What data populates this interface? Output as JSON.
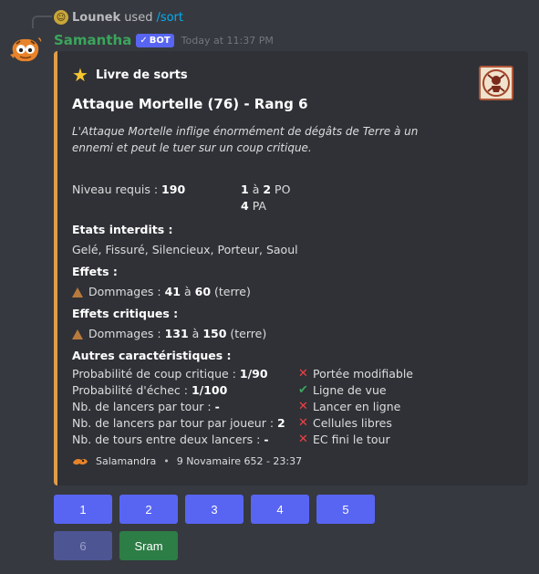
{
  "reply": {
    "user": "Lounek",
    "verb": "used",
    "command": "/sort"
  },
  "message": {
    "author": "Samantha",
    "bot_tag": "BOT",
    "timestamp": "Today at 11:37 PM"
  },
  "embed": {
    "accent_color": "#e09c48",
    "author": "Livre de sorts",
    "title": "Attaque Mortelle (76) - Rang 6",
    "description": "L'Attaque Mortelle inflige énormément de dégâts de Terre à un ennemi et peut le tuer sur un coup critique.",
    "level": {
      "label": "Niveau requis :",
      "value": "190"
    },
    "range": {
      "min": "1",
      "sep": "à",
      "max": "2",
      "unit": "PO"
    },
    "cost": {
      "value": "4",
      "unit": "PA"
    },
    "forbidden_states": {
      "name": "Etats interdits :",
      "value": "Gelé, Fissuré, Silencieux, Porteur, Saoul"
    },
    "effects": {
      "name": "Effets :",
      "label": "Dommages :",
      "min": "41",
      "sep": "à",
      "max": "60",
      "element": "(terre)"
    },
    "critical_effects": {
      "name": "Effets critiques :",
      "label": "Dommages :",
      "min": "131",
      "sep": "à",
      "max": "150",
      "element": "(terre)"
    },
    "other": {
      "name": "Autres caractéristiques :",
      "stats": [
        {
          "label": "Probabilité de coup critique :",
          "value": "1/90"
        },
        {
          "label": "Probabilité d'échec :",
          "value": "1/100"
        },
        {
          "label": "Nb. de lancers par tour :",
          "value": "-"
        },
        {
          "label": "Nb. de lancers par tour par joueur :",
          "value": "2"
        },
        {
          "label": "Nb. de tours entre deux lancers :",
          "value": "-"
        }
      ],
      "flags": [
        {
          "icon": "cross-icon",
          "label": "Portée modifiable"
        },
        {
          "icon": "check-icon",
          "label": "Ligne de vue"
        },
        {
          "icon": "cross-icon",
          "label": "Lancer en ligne"
        },
        {
          "icon": "cross-icon",
          "label": "Cellules libres"
        },
        {
          "icon": "cross-icon",
          "label": "EC fini le tour"
        }
      ]
    },
    "footer": {
      "text": "Salamandra",
      "separator": "•",
      "date": "9 Novamaire 652 - 23:37"
    }
  },
  "buttons": {
    "row1": [
      "1",
      "2",
      "3",
      "4",
      "5"
    ],
    "row2": [
      {
        "label": "6",
        "disabled": true
      },
      {
        "label": "Sram",
        "color": "#2d7d46"
      }
    ]
  }
}
